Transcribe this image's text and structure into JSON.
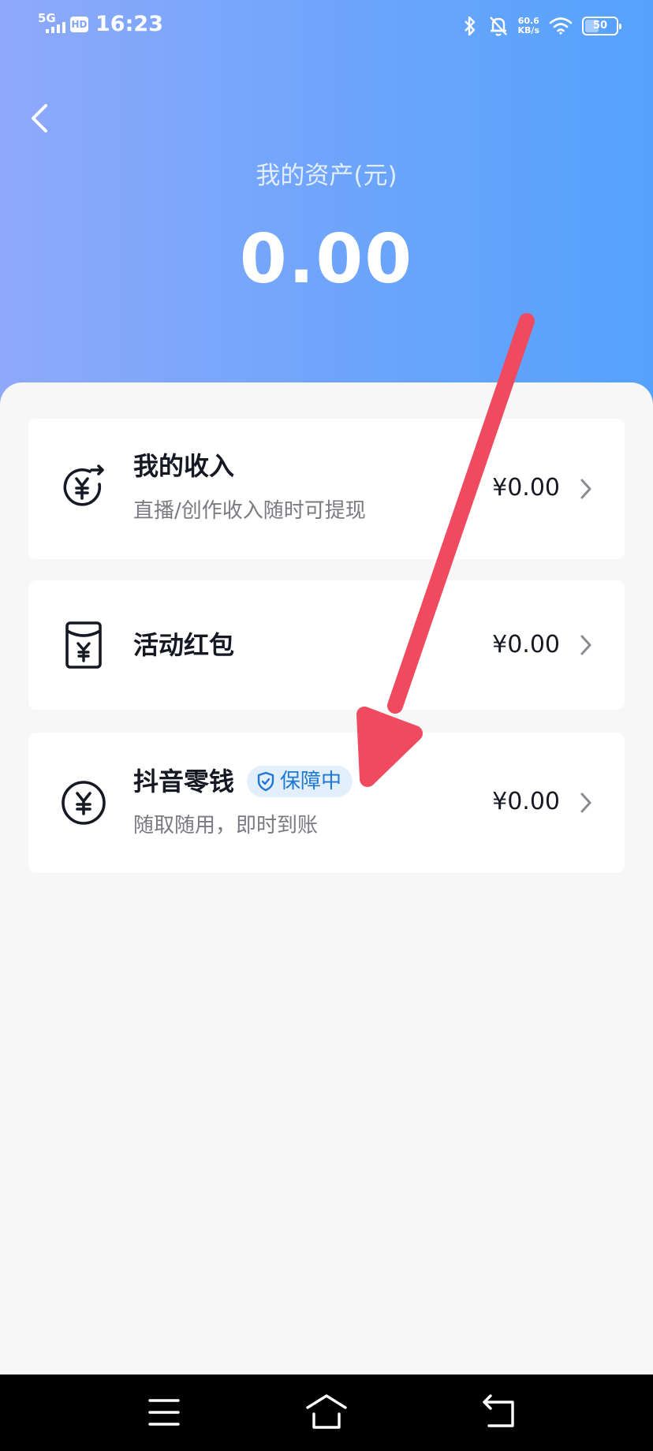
{
  "status_bar": {
    "network": "5G",
    "hd_label": "HD",
    "time": "16:23",
    "speed_value": "60.6",
    "speed_unit": "KB/s",
    "battery": "50",
    "battery_level": 0.5
  },
  "header": {
    "assets_label": "我的资产(元)",
    "assets_value": "0.00"
  },
  "cards": [
    {
      "title": "我的收入",
      "subtitle": "直播/创作收入随时可提现",
      "amount": "¥0.00",
      "icon": "income-yuan-icon"
    },
    {
      "title": "活动红包",
      "amount": "¥0.00",
      "icon": "red-envelope-icon"
    },
    {
      "title": "抖音零钱",
      "badge": "保障中",
      "subtitle": "随取随用，即时到账",
      "amount": "¥0.00",
      "icon": "yuan-coin-icon"
    }
  ],
  "colors": {
    "header_gradient_start": "#8fa9fb",
    "header_gradient_end": "#55a2fd",
    "annotation_arrow": "#ef4a5f",
    "badge_bg": "#e3f0fc",
    "badge_text": "#1f78d4"
  },
  "nav_bar": {
    "icons": [
      "menu-icon",
      "home-icon",
      "back-icon"
    ]
  }
}
